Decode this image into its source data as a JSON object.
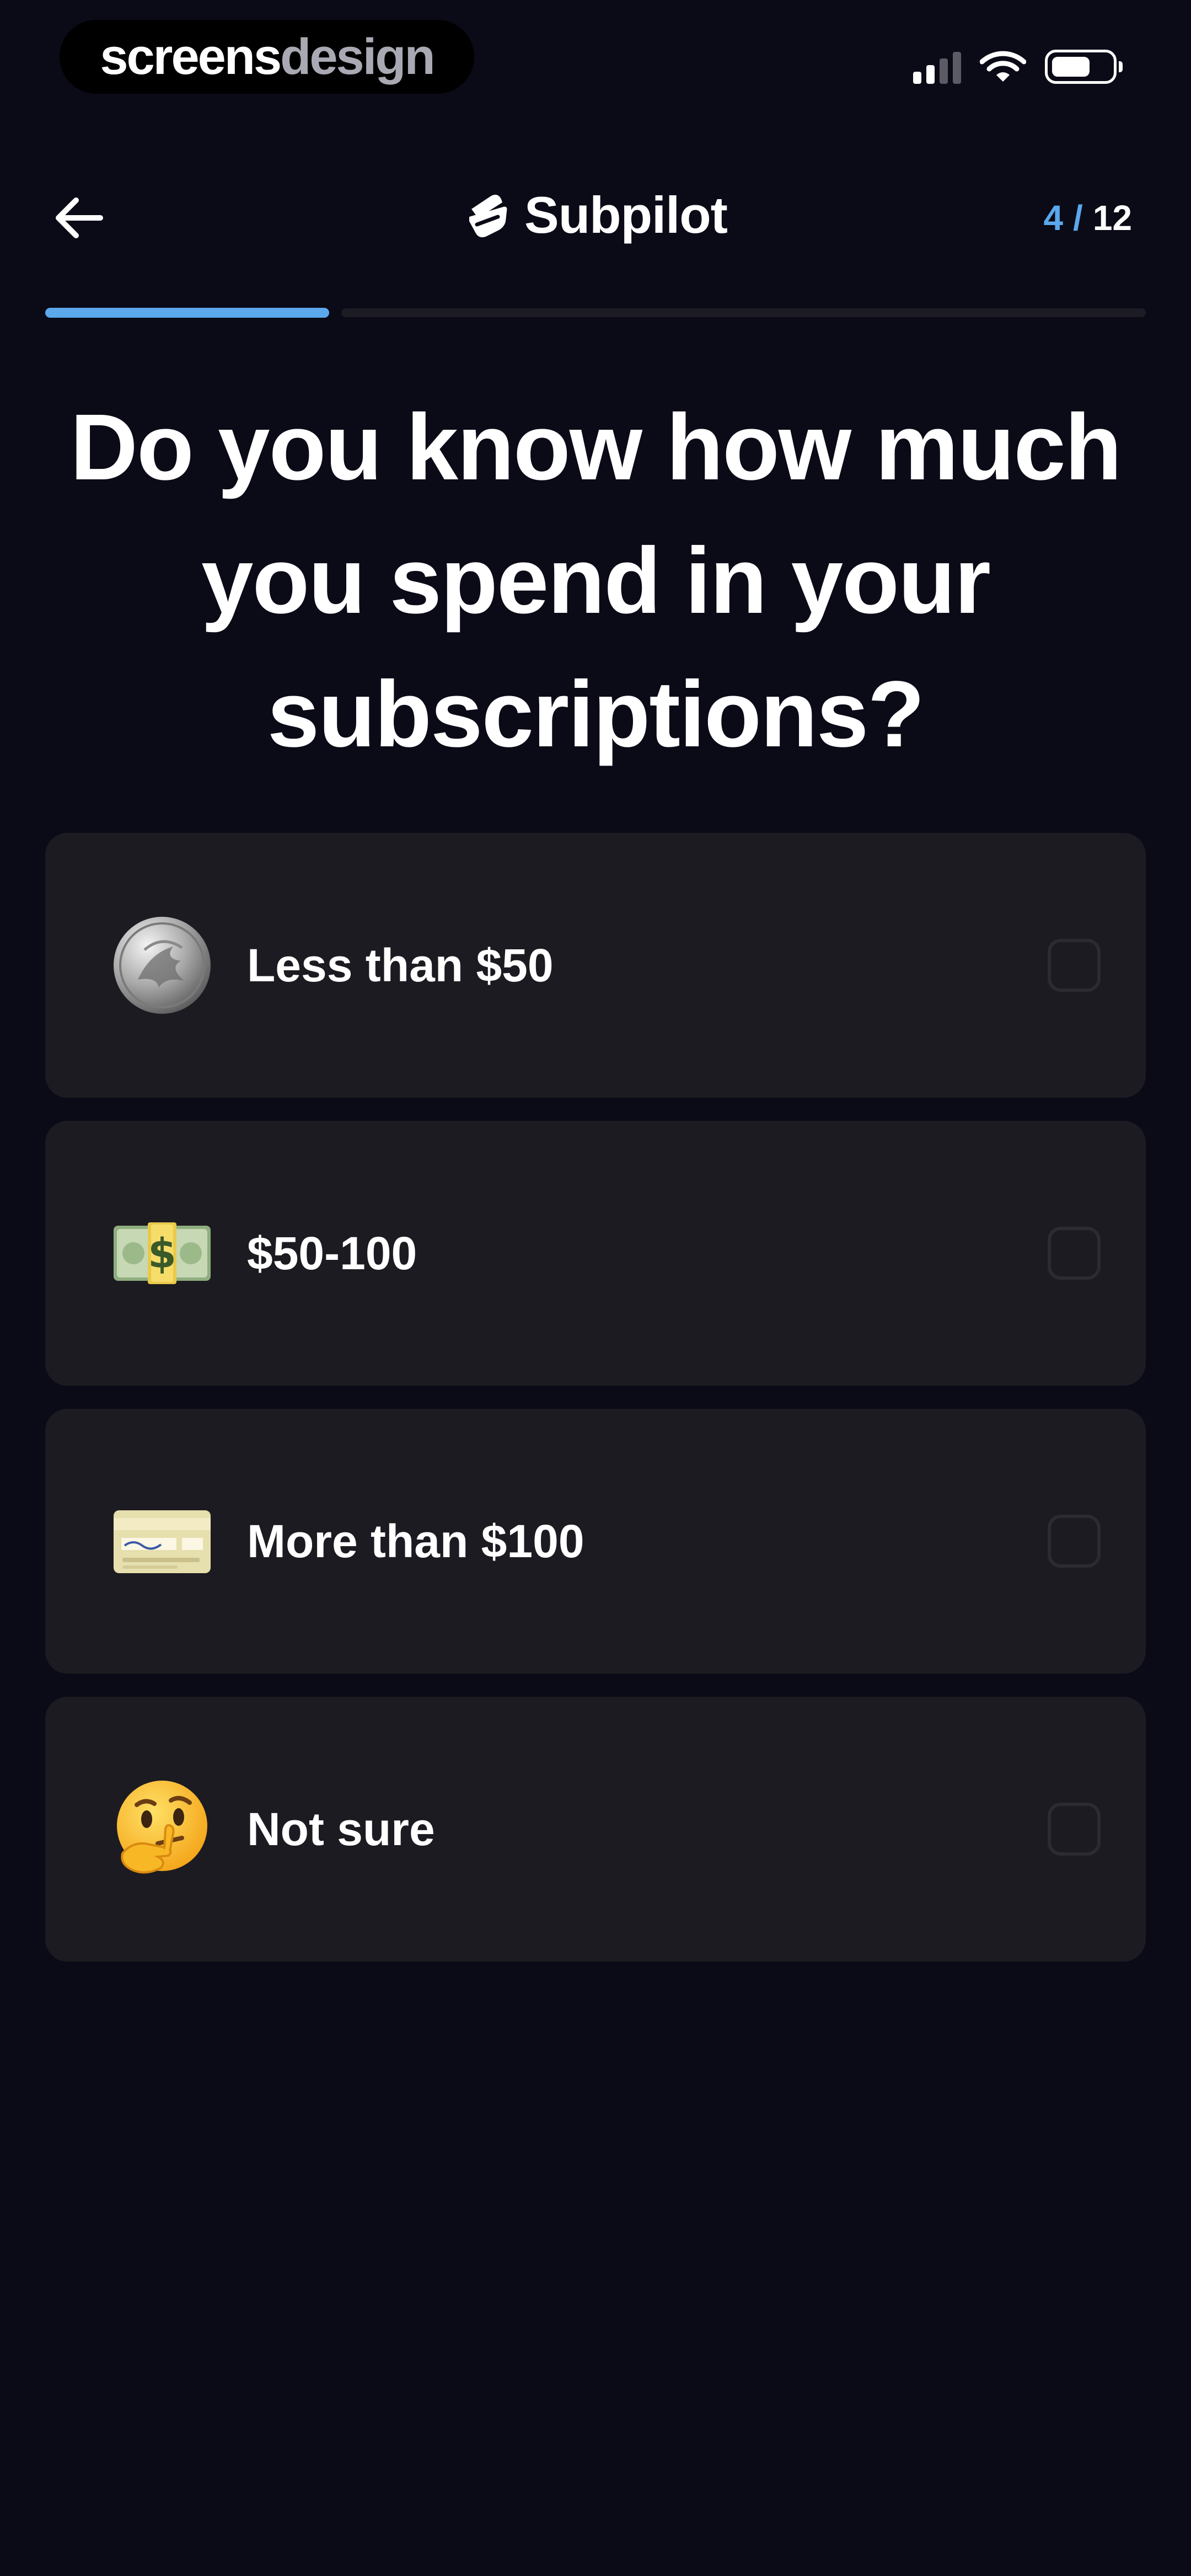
{
  "status_bar": {
    "watermark_part1": "screens",
    "watermark_part2": "design",
    "icons": [
      "signal-icon",
      "wifi-icon",
      "battery-icon"
    ]
  },
  "nav": {
    "back_icon": "arrow-left-icon",
    "brand_icon": "subpilot-logo-icon",
    "brand_name": "Subpilot",
    "step_current": "4",
    "step_separator": "/",
    "step_total": "12"
  },
  "progress": {
    "fraction": 0.333,
    "fill_color": "#5ba8ec"
  },
  "question": {
    "line1": "Do you know how much",
    "line2": "you spend in your",
    "line3": "subscriptions?"
  },
  "options": [
    {
      "icon": "coin-icon",
      "label": "Less than $50",
      "selected": false
    },
    {
      "icon": "dollar-banknote-icon",
      "label": "$50-100",
      "selected": false
    },
    {
      "icon": "credit-card-icon",
      "label": "More than $100",
      "selected": false
    },
    {
      "icon": "thinking-face-icon",
      "label": "Not sure",
      "selected": false
    }
  ],
  "colors": {
    "background": "#0b0a17",
    "card": "#1c1b21",
    "accent": "#5ba8ec"
  }
}
